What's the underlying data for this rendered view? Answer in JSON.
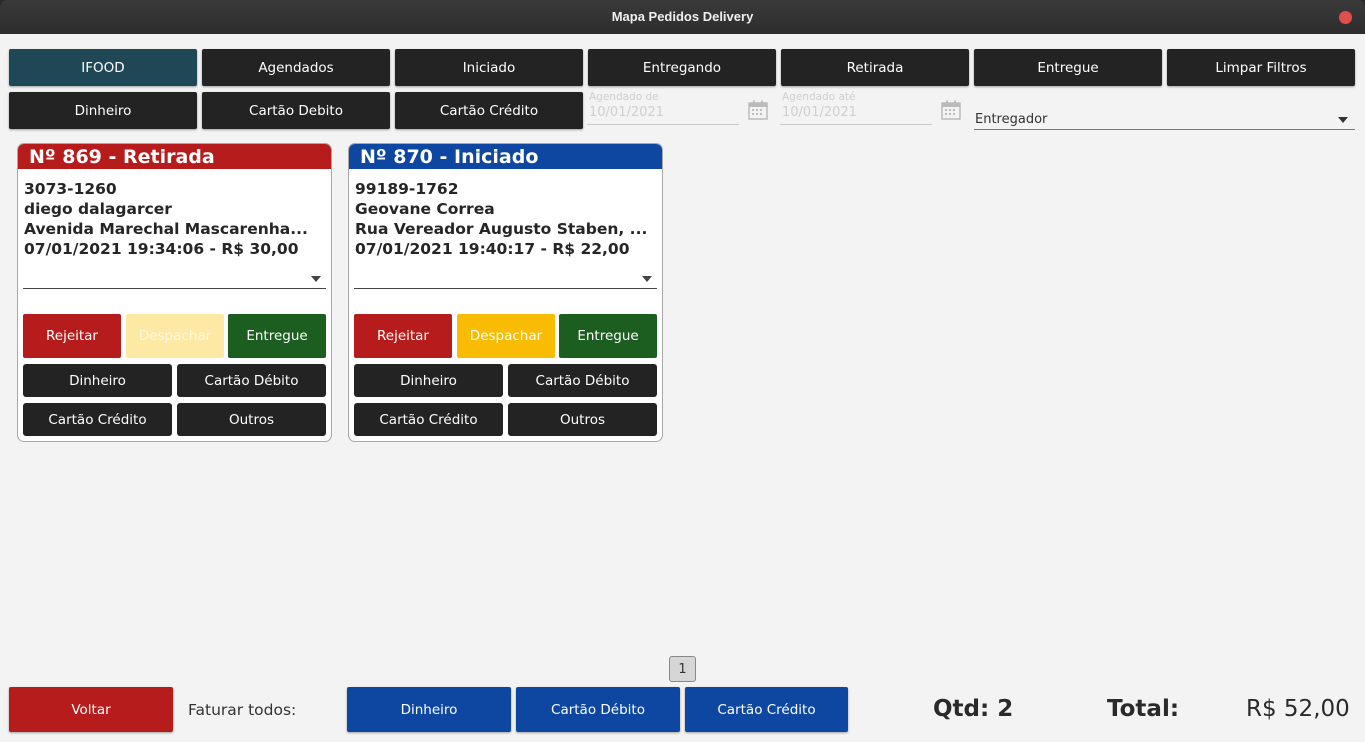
{
  "window": {
    "title": "Mapa Pedidos Delivery"
  },
  "filters": {
    "row1": [
      "IFOOD",
      "Agendados",
      "Iniciado",
      "Entregando",
      "Retirada",
      "Entregue",
      "Limpar Filtros"
    ],
    "row2": [
      "Dinheiro",
      "Cartão Debito",
      "Cartão Crédito"
    ],
    "date_from": {
      "label": "Agendado de",
      "value": "10/01/2021"
    },
    "date_to": {
      "label": "Agendado até",
      "value": "10/01/2021"
    },
    "entregador": "Entregador"
  },
  "orders": [
    {
      "title": "Nº 869 - Retirada",
      "phone": "3073-1260",
      "name": "diego dalagarcer",
      "address": "Avenida Marechal Mascarenha...",
      "datetime_value": "07/01/2021 19:34:06 - R$ 30,00",
      "actions": [
        "Rejeitar",
        "Despachar",
        "Entregue"
      ],
      "payments": [
        "Dinheiro",
        "Cartão Débito",
        "Cartão Crédito",
        "Outros"
      ]
    },
    {
      "title": "Nº 870 - Iniciado",
      "phone": "99189-1762",
      "name": "Geovane Correa",
      "address": "Rua Vereador Augusto Staben, ...",
      "datetime_value": "07/01/2021 19:40:17 - R$ 22,00",
      "actions": [
        "Rejeitar",
        "Despachar",
        "Entregue"
      ],
      "payments": [
        "Dinheiro",
        "Cartão Débito",
        "Cartão Crédito",
        "Outros"
      ]
    }
  ],
  "pagination": {
    "current": "1"
  },
  "footer": {
    "back": "Voltar",
    "faturar_label": "Faturar todos:",
    "faturar_buttons": [
      "Dinheiro",
      "Cartão Débito",
      "Cartão Crédito"
    ],
    "qtd": "Qtd: 2",
    "total_label": "Total:",
    "total_value": "R$ 52,00"
  },
  "colors": {
    "accent_active_filter": "#1f4756",
    "reject": "#b71c1c",
    "dispatch": "#f9bc02",
    "delivered": "#1b5e20",
    "header_retirada": "#b71c1c",
    "header_iniciado": "#0d47a1",
    "footer_blue": "#0d47a1"
  },
  "icons": {
    "calendar": "calendar-icon",
    "close": "close-icon",
    "dropdown": "chevron-down-icon"
  }
}
